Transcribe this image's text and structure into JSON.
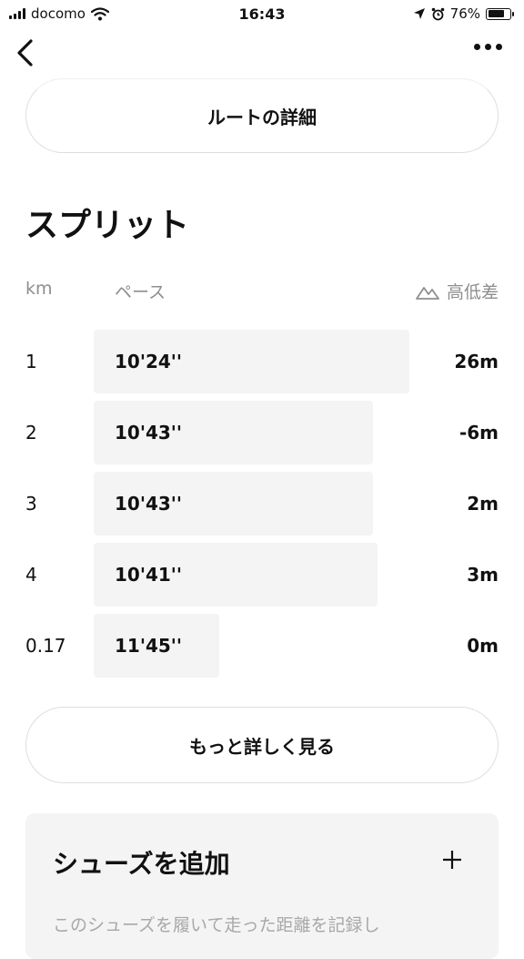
{
  "status_bar": {
    "carrier": "docomo",
    "time": "16:43",
    "battery_percent": "76%",
    "battery_level": 0.76
  },
  "nav": {
    "back_icon": "chevron-left-icon",
    "more_icon": "more-horizontal-icon"
  },
  "route_button": {
    "label": "ルートの詳細"
  },
  "splits": {
    "title": "スプリット",
    "headers": {
      "km": "km",
      "pace": "ペース",
      "elevation": "高低差"
    },
    "rows": [
      {
        "km": "1",
        "pace": "10'24''",
        "elevation": "26m",
        "bar_fraction": 0.78
      },
      {
        "km": "2",
        "pace": "10'43''",
        "elevation": "-6m",
        "bar_fraction": 0.69
      },
      {
        "km": "3",
        "pace": "10'43''",
        "elevation": "2m",
        "bar_fraction": 0.69
      },
      {
        "km": "4",
        "pace": "10'41''",
        "elevation": "3m",
        "bar_fraction": 0.7
      },
      {
        "km": "0.17",
        "pace": "11'45''",
        "elevation": "0m",
        "bar_fraction": 0.31
      }
    ]
  },
  "more_button": {
    "label": "もっと詳しく見る"
  },
  "shoes": {
    "title": "シューズを追加",
    "add_icon": "plus-icon",
    "description": "このシューズを履いて走った距離を記録し"
  }
}
